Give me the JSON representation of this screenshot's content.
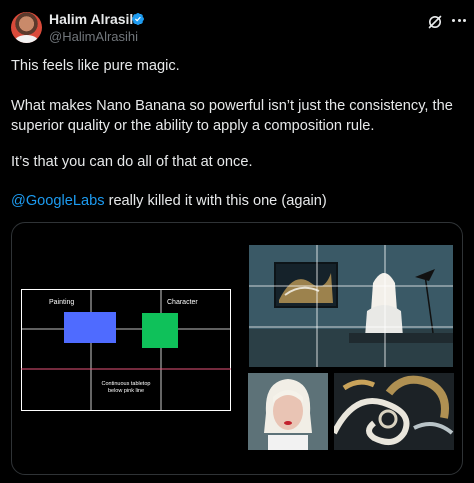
{
  "author": {
    "name": "Halim Alrasihi",
    "handle": "@HalimAlrasihi",
    "verified": true,
    "verified_color": "#1d9bf0"
  },
  "header_icons": [
    "grok-icon",
    "more-icon"
  ],
  "tweet": {
    "line1": "This feels like pure magic.",
    "para2": "What makes Nano Banana so powerful isn’t just the consistency, the superior quality or the ability to apply a composition rule.",
    "para3": "It’s that you can do all of that at once.",
    "mention": "@GoogleLabs",
    "para4_rest": " really killed it with this one (again)"
  },
  "media": {
    "diagram": {
      "label_painting": "Painting",
      "label_character": "Character",
      "label_tabletop_line1": "Continuous tabletop",
      "label_tabletop_line2": "below pink line",
      "painting_color": "#4f6bff",
      "character_color": "#0fc15a",
      "tabletop_line_color": "#e8557a"
    },
    "images": [
      "composed-scene-image",
      "portrait-reference-image",
      "wave-painting-reference-image"
    ]
  },
  "colors": {
    "background": "#000000",
    "text": "#e7e9ea",
    "secondary_text": "#71767b",
    "link": "#1d9bf0",
    "border": "#2f3336"
  }
}
